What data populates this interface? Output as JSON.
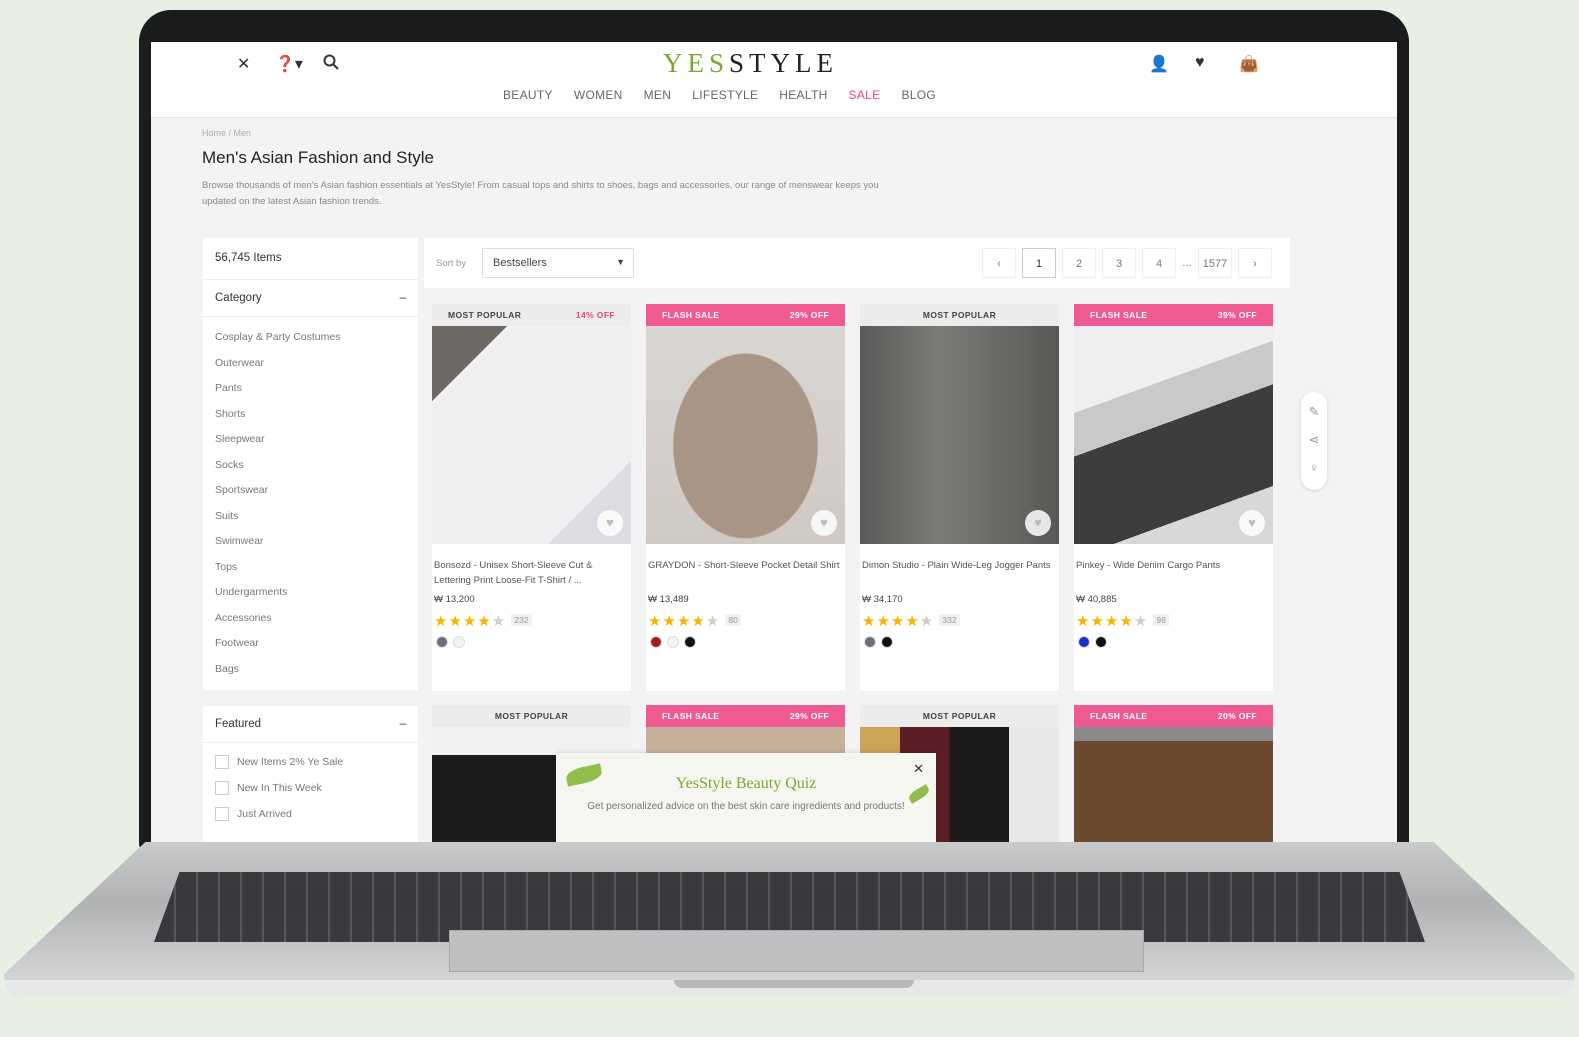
{
  "header": {
    "logo_prefix": "YES",
    "logo_suffix": "STYLE",
    "icons": [
      "close-icon",
      "help-icon",
      "search-icon",
      "account-icon",
      "heart-icon",
      "bag-icon"
    ],
    "nav": [
      "BEAUTY",
      "WOMEN",
      "MEN",
      "LIFESTYLE",
      "HEALTH",
      "SALE",
      "BLOG"
    ],
    "sale_color": "#e5477e",
    "brand_green": "#79a832"
  },
  "breadcrumb": "Home  /  Men",
  "page": {
    "title": "Men's Asian Fashion and Style",
    "description": "Browse thousands of men's Asian fashion essentials at YesStyle! From casual tops and shirts to shoes, bags and accessories, our range of menswear keeps you updated on the latest Asian fashion trends."
  },
  "sidebar": {
    "item_count": "56,745 Items",
    "category_heading": "Category",
    "categories": [
      "Cosplay & Party Costumes",
      "Outerwear",
      "Pants",
      "Shorts",
      "Sleepwear",
      "Socks",
      "Sportswear",
      "Suits",
      "Swimwear",
      "Tops",
      "Undergarments",
      "Accessories",
      "Footwear",
      "Bags"
    ],
    "featured_heading": "Featured",
    "featured": [
      "New Items 2% Ye Sale",
      "New In This Week",
      "Just Arrived"
    ]
  },
  "toolbar": {
    "sort_label": "Sort by",
    "sort_value": "Bestsellers",
    "pages": [
      "‹",
      "1",
      "2",
      "3",
      "4",
      "...",
      "1577",
      "›"
    ]
  },
  "products": [
    {
      "badge": "MOST POPULAR",
      "off": "14% OFF",
      "type": "pop",
      "name": "Bonsozd - Unisex Short-Sleeve Cut & Lettering Print Loose-Fit T-Shirt / ...",
      "price": "₩ 13,200",
      "stars": "★★★★",
      "dim_stars": "★",
      "reviews": "232",
      "swatches": [
        "#6e6e80",
        "#f2f2f2"
      ]
    },
    {
      "badge": "FLASH SALE",
      "off": "29% OFF",
      "type": "flash",
      "name": "GRAYDON - Short-Sleeve Pocket Detail Shirt",
      "price": "₩ 13,489",
      "stars": "★★★★",
      "dim_stars": "★",
      "reviews": "80",
      "swatches": [
        "#a21c1c",
        "#f5f5f5",
        "#111111"
      ]
    },
    {
      "badge": "MOST POPULAR",
      "off": "",
      "type": "pop",
      "name": "Dimon Studio - Plain Wide-Leg Jogger Pants",
      "price": "₩ 34,170",
      "stars": "★★★★",
      "dim_stars": "★",
      "reviews": "332",
      "swatches": [
        "#6e6e80",
        "#111111"
      ]
    },
    {
      "badge": "FLASH SALE",
      "off": "39% OFF",
      "type": "flash",
      "name": "Pinkey - Wide Denim Cargo Pants",
      "price": "₩ 40,885",
      "stars": "★★★★",
      "dim_stars": "★",
      "reviews": "98",
      "swatches": [
        "#1630c8",
        "#111111"
      ]
    },
    {
      "badge": "MOST POPULAR",
      "off": "",
      "type": "pop"
    },
    {
      "badge": "FLASH SALE",
      "off": "29% OFF",
      "type": "flash"
    },
    {
      "badge": "MOST POPULAR",
      "off": "",
      "type": "pop"
    },
    {
      "badge": "FLASH SALE",
      "off": "20% OFF",
      "type": "flash"
    }
  ],
  "quiz": {
    "title": "YesStyle Beauty Quiz",
    "text": "Get personalized advice on the best skin care ingredients and products!"
  }
}
